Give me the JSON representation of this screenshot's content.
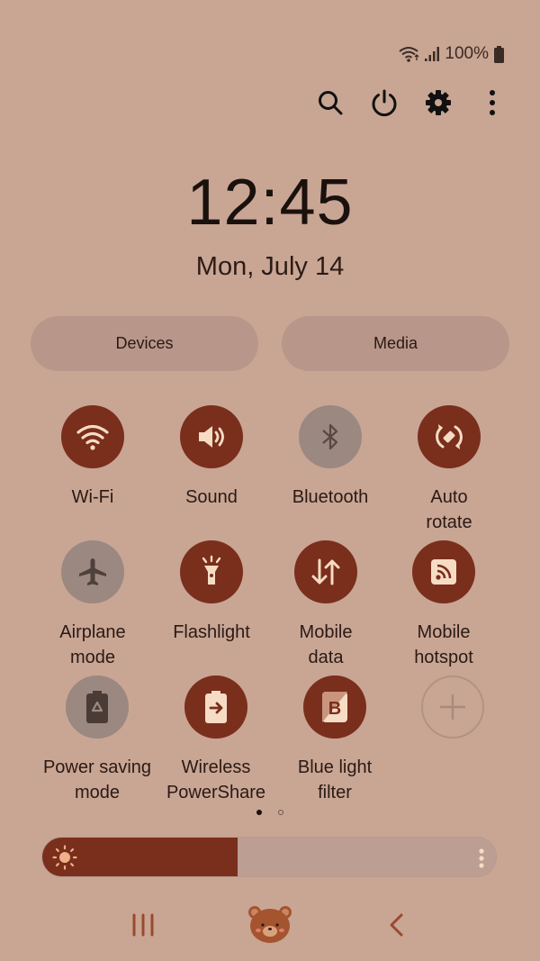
{
  "status_bar": {
    "battery_text": "100%",
    "icons": [
      "wifi-icon",
      "signal-icon",
      "battery-icon"
    ]
  },
  "top_actions": [
    {
      "name": "search",
      "icon": "search-icon"
    },
    {
      "name": "power",
      "icon": "power-icon"
    },
    {
      "name": "settings",
      "icon": "gear-icon"
    },
    {
      "name": "more",
      "icon": "more-vertical-icon"
    }
  ],
  "clock": {
    "time": "12:45",
    "date": "Mon, July 14"
  },
  "pills": {
    "devices": "Devices",
    "media": "Media"
  },
  "tiles": [
    {
      "label": "Wi-Fi",
      "icon": "wifi-icon",
      "state": "on"
    },
    {
      "label": "Sound",
      "icon": "sound-icon",
      "state": "on"
    },
    {
      "label": "Bluetooth",
      "icon": "bluetooth-icon",
      "state": "off"
    },
    {
      "label": "Auto\nrotate",
      "icon": "auto-rotate-icon",
      "state": "on"
    },
    {
      "label": "Airplane\nmode",
      "icon": "airplane-icon",
      "state": "off"
    },
    {
      "label": "Flashlight",
      "icon": "flashlight-icon",
      "state": "on"
    },
    {
      "label": "Mobile\ndata",
      "icon": "mobile-data-icon",
      "state": "on"
    },
    {
      "label": "Mobile\nhotspot",
      "icon": "hotspot-icon",
      "state": "on"
    },
    {
      "label": "Power saving\nmode",
      "icon": "power-saving-icon",
      "state": "off"
    },
    {
      "label": "Wireless\nPowerShare",
      "icon": "powershare-icon",
      "state": "on"
    },
    {
      "label": "Blue light\nfilter",
      "icon": "blue-light-filter-icon",
      "state": "on"
    },
    {
      "label": "",
      "icon": "add-icon",
      "state": "add"
    }
  ],
  "page_indicator": {
    "current": 1,
    "total": 2
  },
  "brightness": {
    "level_percent": 43,
    "icon": "sun-icon"
  },
  "colors": {
    "background": "#c9a594",
    "accent_on": "#7a2e1c",
    "tile_off": "#9b8880",
    "icon_on": "#f6dcc4"
  },
  "nav_bar": {
    "recents": "recents-icon",
    "home": "bear-home-icon",
    "back": "back-icon"
  }
}
